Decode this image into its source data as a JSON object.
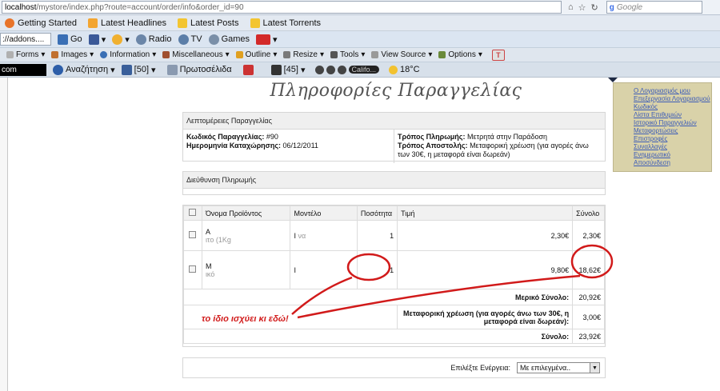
{
  "browser": {
    "url_host": "localhost",
    "url_rest": "/mystore/index.php?route=account/order/info&order_id=90",
    "search_placeholder": "Google",
    "bookmarks": [
      "Getting Started",
      "Latest Headlines",
      "Latest Posts",
      "Latest Torrents"
    ],
    "toolbar2": {
      "field_value": "://addons....",
      "go_label": "Go",
      "radio_label": "Radio",
      "tv_label": "TV",
      "games_label": "Games"
    },
    "toolbar3": [
      "Forms",
      "Images",
      "Information",
      "Miscellaneous",
      "Outline",
      "Resize",
      "Tools",
      "View Source",
      "Options"
    ],
    "toolbar4": {
      "black_field": "com",
      "search_label": "Αναζήτηση",
      "rss_count": "[50]",
      "home_label": "Πρωτοσέλιδα",
      "mail_count": "[45]",
      "player_label": "Califo...",
      "temperature": "18°C"
    }
  },
  "page": {
    "title": "Πληροφορίες Παραγγελίας",
    "order_details": {
      "heading": "Λεπτομέρειες Παραγγελίας",
      "order_id_label": "Κωδικός Παραγγελίας:",
      "order_id": "#90",
      "date_label": "Ημερομηνία Καταχώρησης:",
      "date": "06/12/2011",
      "payment_label": "Τρόπος Πληρωμής:",
      "payment": "Μετρητά στην Παράδοση",
      "shipping_label": "Τρόπος Αποστολής:",
      "shipping": "Μεταφορική χρέωση (για αγορές άνω των 30€, η μεταφορά είναι δωρεάν)"
    },
    "payment_address": {
      "heading": "Διεύθυνση Πληρωμής"
    },
    "products": {
      "headers": [
        "Όνομα Προϊόντος",
        "Μοντέλο",
        "Ποσότητα",
        "Τιμή",
        "Σύνολο"
      ],
      "rows": [
        {
          "name": "Α",
          "name_extra": "ιτο (1Kg",
          "model": "Ι",
          "model_extra": "να",
          "qty": "1",
          "price": "2,30€",
          "total": "2,30€"
        },
        {
          "name": "Μ",
          "name_extra": "ικό",
          "model": "Ι",
          "model_extra": "",
          "qty": "1",
          "price": "9,80€",
          "total": "18,62€"
        }
      ],
      "summary": [
        {
          "label": "Μερικό Σύνολο:",
          "value": "20,92€"
        },
        {
          "label": "Μεταφορική χρέωση (για αγορές άνω των 30€, η μεταφορά είναι δωρεάν):",
          "value": "3,00€"
        },
        {
          "label": "Σύνολο:",
          "value": "23,92€"
        }
      ]
    },
    "action": {
      "label": "Επιλέξτε Ενέργεια:",
      "selected": "Με επιλεγμένα.."
    },
    "annotation": "το ίδιο ισχύει κι εδώ!",
    "account_menu": [
      "Ο Λογαριασμός μου",
      "Επεξεργασία Λογαριασμού",
      "Κωδικός",
      "Λίστα Επιθυμιών",
      "Ιστορικό Παραγγελιών",
      "Μεταφορτώσεις",
      "Επιστροφές",
      "Συναλλαγές",
      "Ενημερωτικό",
      "Αποσύνδεση"
    ],
    "colors": {
      "annotation": "#d11a1a",
      "menu_bg": "#d9d2a9",
      "link": "#3b5bb8"
    }
  }
}
